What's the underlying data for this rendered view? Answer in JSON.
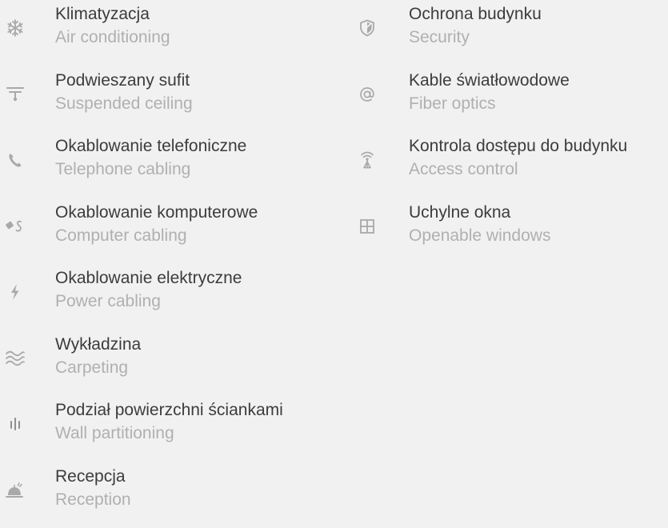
{
  "colors": {
    "background": "#f1f1f1",
    "primary_text": "#3c3c3c",
    "secondary_text": "#b0b0b0",
    "icon": "#a9a9a9"
  },
  "features_left": [
    {
      "icon": "snowflake-icon",
      "label_pl": "Klimatyzacja",
      "label_en": "Air conditioning"
    },
    {
      "icon": "ceiling-lamp-icon",
      "label_pl": "Podwieszany sufit",
      "label_en": "Suspended ceiling"
    },
    {
      "icon": "phone-icon",
      "label_pl": "Okablowanie telefoniczne",
      "label_en": "Telephone cabling"
    },
    {
      "icon": "network-cable-icon",
      "label_pl": "Okablowanie komputerowe",
      "label_en": "Computer cabling"
    },
    {
      "icon": "lightning-icon",
      "label_pl": "Okablowanie elektryczne",
      "label_en": "Power cabling"
    },
    {
      "icon": "waves-icon",
      "label_pl": "Wykładzina",
      "label_en": "Carpeting"
    },
    {
      "icon": "partition-icon",
      "label_pl": "Podział powierzchni ściankami",
      "label_en": "Wall partitioning"
    },
    {
      "icon": "reception-bell-icon",
      "label_pl": "Recepcja",
      "label_en": "Reception"
    }
  ],
  "features_right": [
    {
      "icon": "shield-icon",
      "label_pl": "Ochrona budynku",
      "label_en": "Security"
    },
    {
      "icon": "at-sign-icon",
      "label_pl": "Kable światłowodowe",
      "label_en": "Fiber optics"
    },
    {
      "icon": "antenna-icon",
      "label_pl": "Kontrola dostępu do budynku",
      "label_en": "Access control"
    },
    {
      "icon": "window-icon",
      "label_pl": "Uchylne okna",
      "label_en": "Openable windows"
    }
  ]
}
